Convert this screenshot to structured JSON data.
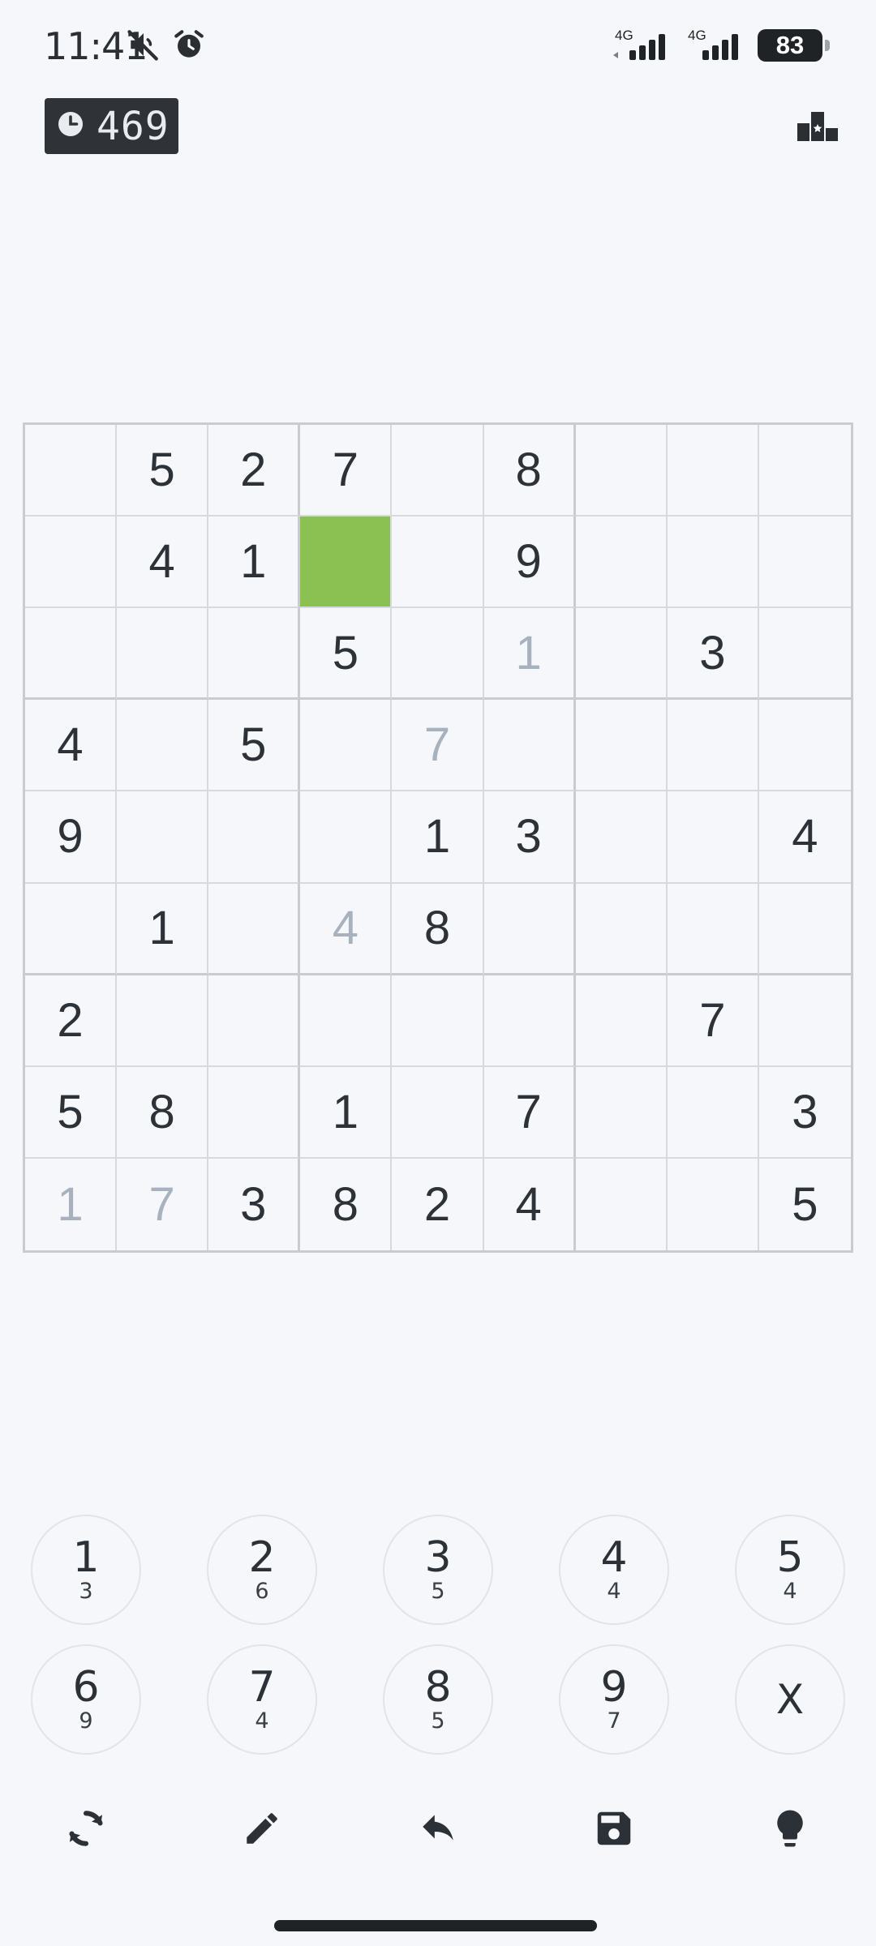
{
  "status_bar": {
    "time": "11:41",
    "network_labels": [
      "4G",
      "4G"
    ],
    "battery": "83"
  },
  "header": {
    "timer_value": "469",
    "timer_icon": "clock-icon",
    "leaderboard_icon": "leaderboard-icon"
  },
  "grid": {
    "rows": [
      [
        "",
        "5",
        "2",
        "7",
        "",
        "8",
        "",
        "",
        ""
      ],
      [
        "",
        "4",
        "1",
        "",
        "",
        "9",
        "",
        "",
        ""
      ],
      [
        "",
        "",
        "",
        "5",
        "",
        "1",
        "",
        "3",
        ""
      ],
      [
        "4",
        "",
        "5",
        "",
        "7",
        "",
        "",
        "",
        ""
      ],
      [
        "9",
        "",
        "",
        "",
        "1",
        "3",
        "",
        "",
        "4"
      ],
      [
        "",
        "1",
        "",
        "4",
        "8",
        "",
        "",
        "",
        ""
      ],
      [
        "2",
        "",
        "",
        "",
        "",
        "",
        "",
        "7",
        ""
      ],
      [
        "5",
        "8",
        "",
        "1",
        "",
        "7",
        "",
        "",
        "3"
      ],
      [
        "1",
        "7",
        "3",
        "8",
        "2",
        "4",
        "",
        "",
        "5"
      ]
    ],
    "hint_cells": [
      [
        2,
        5
      ],
      [
        3,
        4
      ],
      [
        5,
        3
      ],
      [
        8,
        0
      ],
      [
        8,
        1
      ]
    ],
    "selected_cell": [
      1,
      3
    ],
    "selected_color": "#8bc152",
    "hint_color": "#a8b2bf"
  },
  "keypad": {
    "keys": [
      {
        "number": "1",
        "count": "3"
      },
      {
        "number": "2",
        "count": "6"
      },
      {
        "number": "3",
        "count": "5"
      },
      {
        "number": "4",
        "count": "4"
      },
      {
        "number": "5",
        "count": "4"
      },
      {
        "number": "6",
        "count": "9"
      },
      {
        "number": "7",
        "count": "4"
      },
      {
        "number": "8",
        "count": "5"
      },
      {
        "number": "9",
        "count": "7"
      }
    ],
    "clear_label": "X"
  },
  "toolbar": {
    "icons": [
      "restart-icon",
      "pencil-icon",
      "undo-icon",
      "save-icon",
      "hint-bulb-icon"
    ]
  }
}
